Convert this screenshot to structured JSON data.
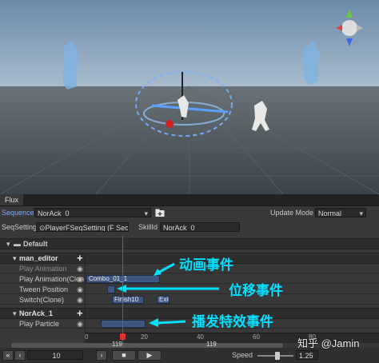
{
  "window": {
    "tab_label": "Flux"
  },
  "sequence": {
    "label": "Sequence",
    "value": "NorAck_0",
    "add_icon": "add-folder-icon",
    "update_mode_label": "Update Mode",
    "update_mode_value": "Normal"
  },
  "seqsetting": {
    "label": "SeqSetting",
    "value": "PlayerFSeqSetting (F Sec",
    "skill_label": "SkillId",
    "skill_value": "NorAck_0"
  },
  "timeline": {
    "root_label": "Default",
    "groups": [
      {
        "name": "man_editor",
        "tracks": [
          {
            "label": "Play Animation",
            "dimmed": true,
            "events": []
          },
          {
            "label": "Play Animation(Clon",
            "events": [
              {
                "label": "Combo_01_1"
              }
            ]
          },
          {
            "label": "Tween Position",
            "events": [
              {
                "label": ""
              }
            ]
          },
          {
            "label": "Switch(Clone)",
            "events": [
              {
                "label": "Finish10"
              },
              {
                "label": "Exit"
              }
            ]
          }
        ]
      },
      {
        "name": "NorAck_1",
        "tracks": [
          {
            "label": "Play Particle",
            "events": [
              {
                "label": ""
              }
            ]
          }
        ]
      }
    ],
    "ruler_ticks": [
      "0",
      "20",
      "40",
      "60",
      "80"
    ],
    "playhead_frame": "119",
    "end_frame": "119"
  },
  "annotations": {
    "animation_event": "动画事件",
    "position_event": "位移事件",
    "particle_event": "播发特效事件"
  },
  "controls": {
    "frame_value": "10",
    "speed_label": "Speed",
    "speed_value": "1.25",
    "speed_fraction": 0.55
  },
  "watermark": "知乎 @Jamin",
  "colors": {
    "annotation": "#00e0ff",
    "playhead": "#e03030",
    "event": "#3f5680"
  }
}
